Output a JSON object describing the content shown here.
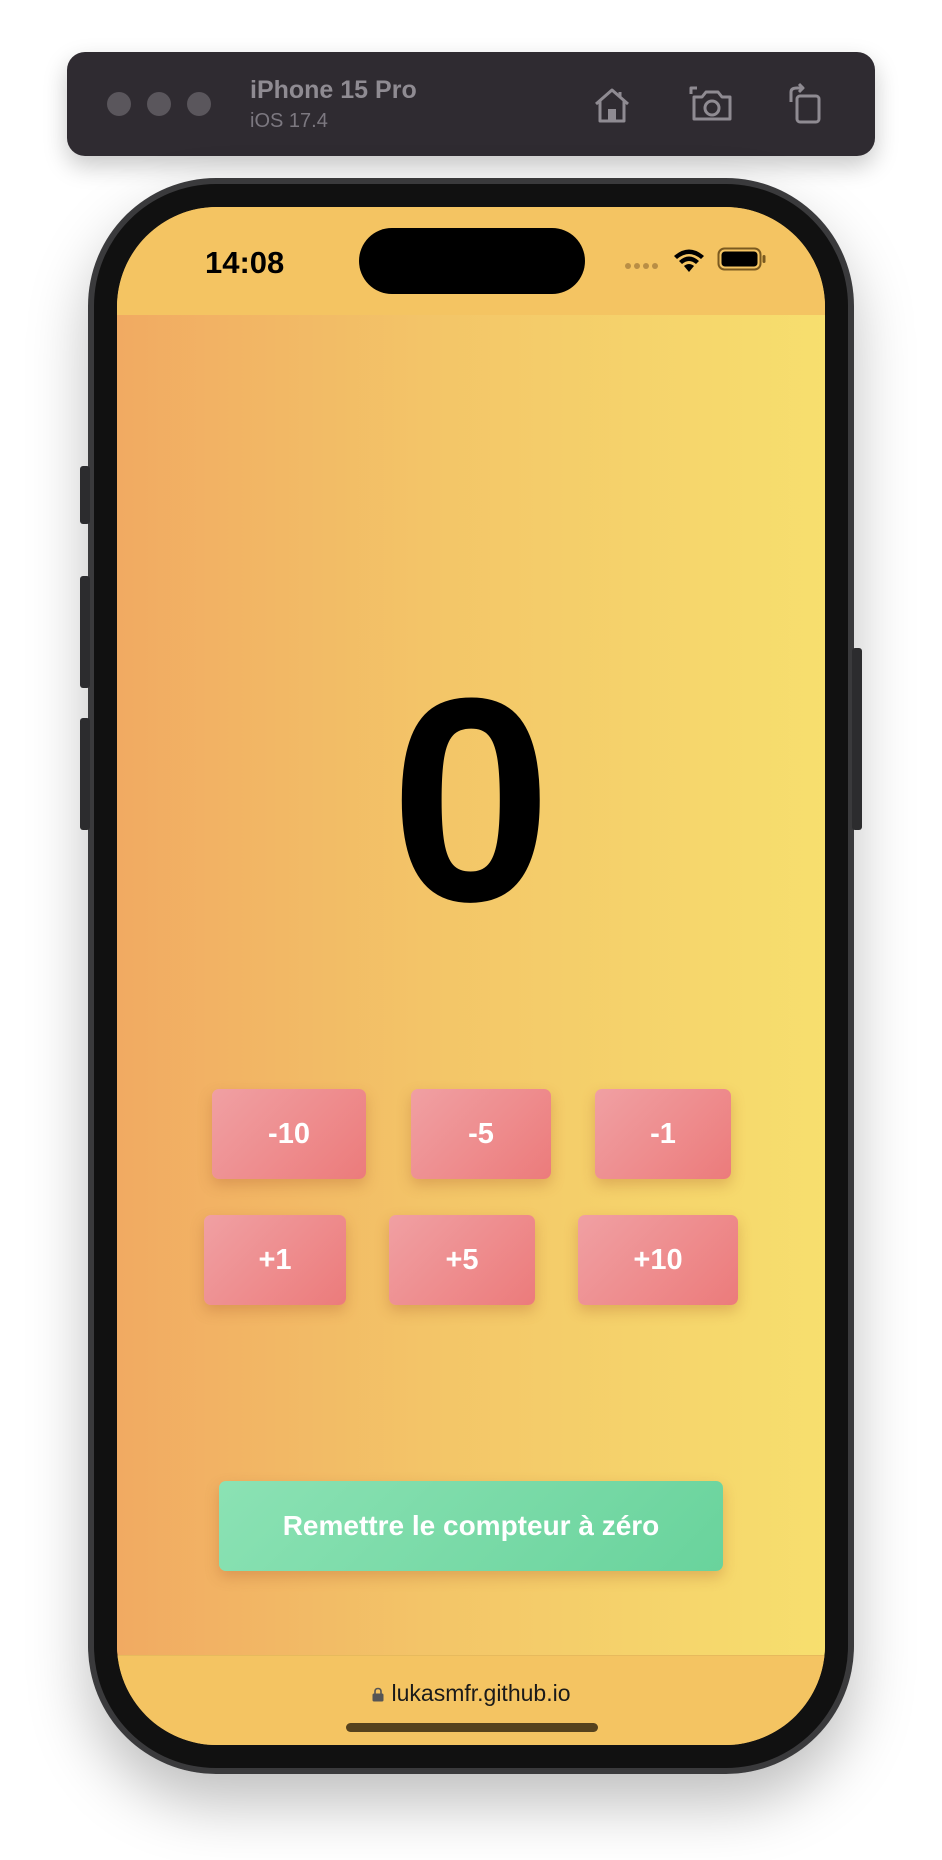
{
  "simulator": {
    "device_name": "iPhone 15 Pro",
    "os_version": "iOS 17.4",
    "toolbar_icons": [
      "home-icon",
      "screenshot-camera-icon",
      "rotate-icon"
    ]
  },
  "status_bar": {
    "time": "14:08",
    "icons": [
      "cellular-signal-icon",
      "wifi-icon",
      "battery-icon"
    ]
  },
  "counter": {
    "value": "0"
  },
  "buttons": {
    "minus_10": "-10",
    "minus_5": "-5",
    "minus_1": "-1",
    "plus_1": "+1",
    "plus_5": "+5",
    "plus_10": "+10",
    "reset": "Remettre le compteur à zéro"
  },
  "browser": {
    "address": "lukasmfr.github.io"
  },
  "colors": {
    "gradient_left": "#f1aa62",
    "gradient_right": "#f7df6e",
    "button_red": "#ec7b7b",
    "button_green": "#69d39c"
  }
}
